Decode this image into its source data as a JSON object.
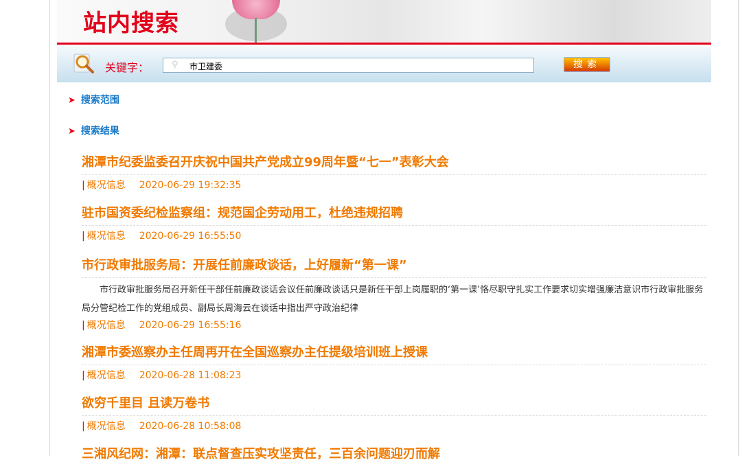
{
  "header": {
    "title": "站内搜索"
  },
  "search": {
    "label": "关键字：",
    "value": "市卫建委",
    "button": "搜索"
  },
  "sections": {
    "scope": "搜索范围",
    "results": "搜索结果"
  },
  "results": [
    {
      "title": "湘潭市纪委监委召开庆祝中国共产党成立99周年暨“七一”表彰大会",
      "category": "概况信息",
      "date": "2020-06-29 19:32:35"
    },
    {
      "title": "驻市国资委纪检监察组：规范国企劳动用工，杜绝违规招聘",
      "category": "概况信息",
      "date": "2020-06-29 16:55:50"
    },
    {
      "title": "市行政审批服务局：开展任前廉政谈话，上好履新“第一课”",
      "desc": "市行政审批服务局召开新任干部任前廉政谈话会议任前廉政谈话只是新任干部上岗履职的‘第一课’恪尽职守扎实工作要求切实增强廉洁意识市行政审批服务局分管纪检工作的党组成员、副局长周海云在谈话中指出严守政治纪律",
      "category": "概况信息",
      "date": "2020-06-29 16:55:16"
    },
    {
      "title": "湘潭市委巡察办主任周再开在全国巡察办主任提级培训班上授课",
      "category": "概况信息",
      "date": "2020-06-28 11:08:23"
    },
    {
      "title": "欲穷千里目 且读万卷书",
      "category": "概况信息",
      "date": "2020-06-28 10:58:08"
    },
    {
      "title": "三湘风纪网：湘潭：联点督查压实攻坚责任，三百余问题迎刃而解"
    }
  ]
}
